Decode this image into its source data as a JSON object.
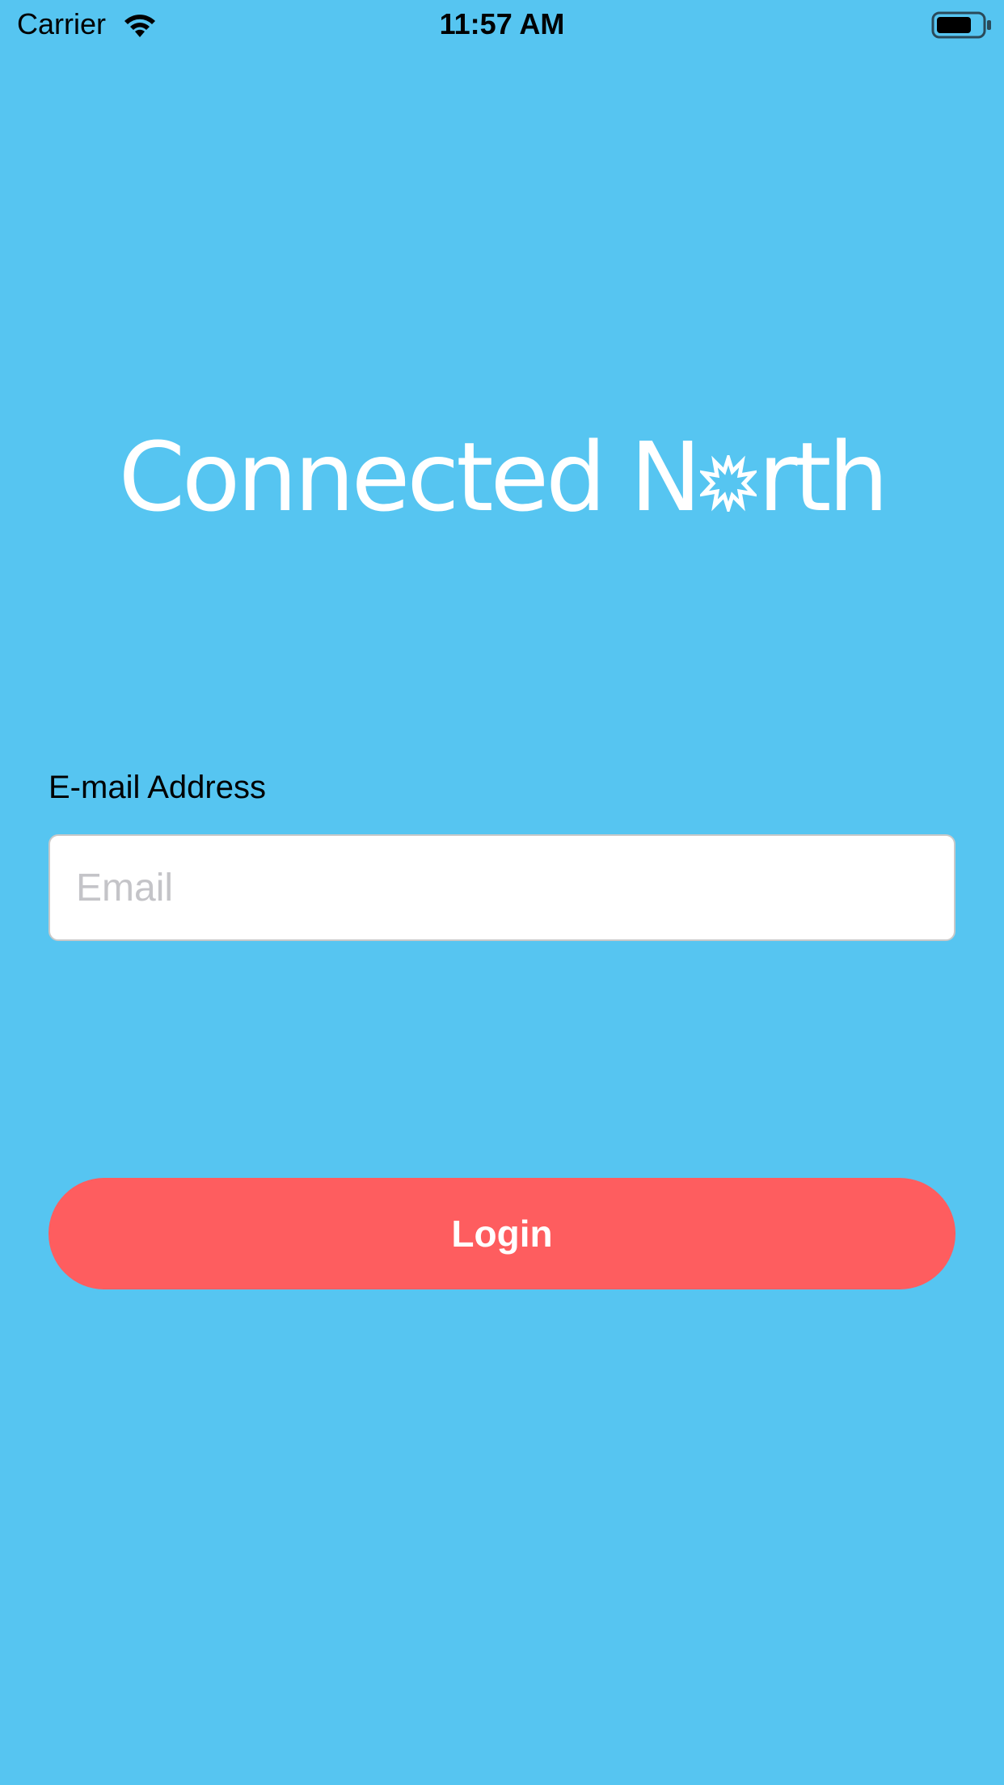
{
  "status_bar": {
    "carrier": "Carrier",
    "time": "11:57 AM",
    "wifi_icon": "wifi-icon",
    "battery_icon": "battery-icon"
  },
  "logo": {
    "text_part1": "Connected N",
    "text_part2": "rth",
    "burst_icon": "sunburst-icon"
  },
  "form": {
    "email_label": "E-mail Address",
    "email_placeholder": "Email",
    "email_value": "",
    "login_label": "Login"
  },
  "colors": {
    "background": "#56c5f1",
    "login_button": "#fe5d5f",
    "logo_text": "#ffffff",
    "input_background": "#ffffff"
  }
}
